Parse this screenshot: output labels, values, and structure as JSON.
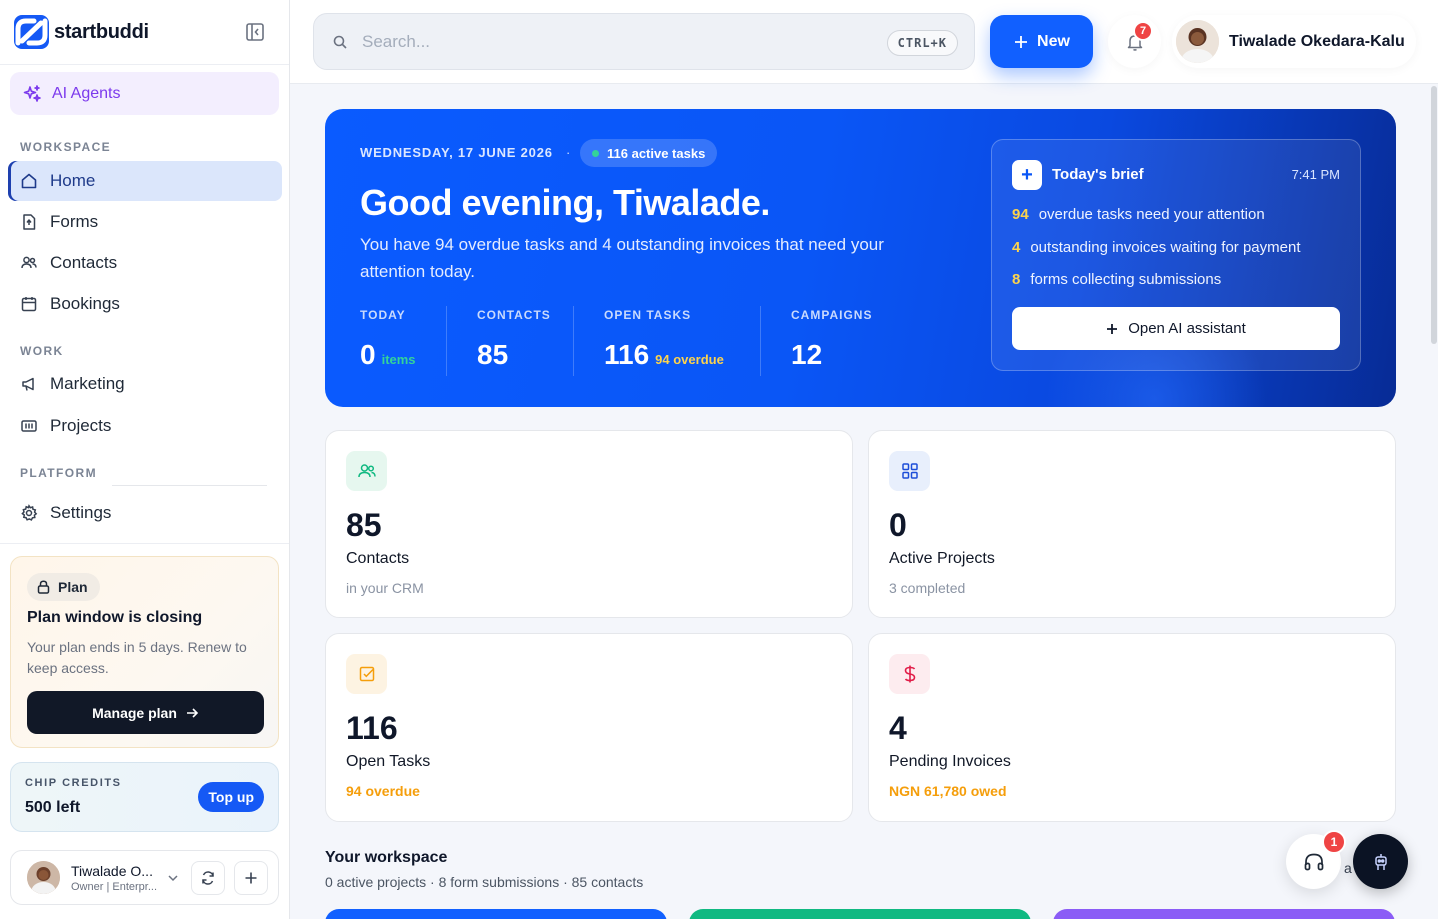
{
  "brand": {
    "name": "startbuddi"
  },
  "sidebar": {
    "ai_agents": "AI Agents",
    "sections": {
      "workspace": "WORKSPACE",
      "work": "WORK",
      "platform": "PLATFORM"
    },
    "items": {
      "home": "Home",
      "forms": "Forms",
      "contacts": "Contacts",
      "bookings": "Bookings",
      "marketing": "Marketing",
      "projects": "Projects",
      "settings": "Settings"
    },
    "active_item": "Home"
  },
  "plan": {
    "badge": "Plan",
    "title": "Plan window is closing",
    "description": "Your plan ends in 5 days. Renew to keep access.",
    "button": "Manage plan"
  },
  "credits": {
    "label": "CHIP CREDITS",
    "value": "500 left",
    "button": "Top up"
  },
  "user": {
    "name": "Tiwalade O...",
    "role": "Owner | Enterpr..."
  },
  "topbar": {
    "search_placeholder": "Search...",
    "shortcut": "CTRL+K",
    "new_button": "New",
    "notifications_count": "7",
    "profile_name": "Tiwalade Okedara-Kalu"
  },
  "hero": {
    "date": "WEDNESDAY, 17 JUNE 2026",
    "separator": "·",
    "active_tasks": "116 active tasks",
    "greeting": "Good evening, Tiwalade.",
    "subtitle": "You have 94 overdue tasks and 4 outstanding invoices that need your attention today.",
    "stats": [
      {
        "label": "TODAY",
        "value": "0",
        "note": "items"
      },
      {
        "label": "CONTACTS",
        "value": "85",
        "note": ""
      },
      {
        "label": "OPEN TASKS",
        "value": "116",
        "note": "94 overdue"
      },
      {
        "label": "CAMPAIGNS",
        "value": "12",
        "note": ""
      }
    ],
    "brief": {
      "title": "Today's brief",
      "time": "7:41 PM",
      "rows": [
        {
          "num": "94",
          "text": "overdue tasks need your attention"
        },
        {
          "num": "4",
          "text": "outstanding invoices waiting for payment"
        },
        {
          "num": "8",
          "text": "forms collecting submissions"
        }
      ],
      "button": "Open AI assistant"
    }
  },
  "cards": [
    {
      "value": "85",
      "label": "Contacts",
      "sub": "in your CRM",
      "icon": "users-icon",
      "accent": "#10b981"
    },
    {
      "value": "0",
      "label": "Active Projects",
      "sub": "3 completed",
      "icon": "grid-icon",
      "accent": "#1d4ed8"
    },
    {
      "value": "116",
      "label": "Open Tasks",
      "sub": "94 overdue",
      "icon": "check-square-icon",
      "accent": "#f59e0b"
    },
    {
      "value": "4",
      "label": "Pending Invoices",
      "sub": "NGN 61,780 owed",
      "icon": "dollar-icon",
      "accent": "#e11d48"
    }
  ],
  "workspace": {
    "title": "Your workspace",
    "subtitle": "0 active projects · 8 form submissions · 85 contacts"
  },
  "floating": {
    "help_badge": "1",
    "help_peek": "a"
  },
  "colors": {
    "brand_blue": "#1160ff",
    "hero_blue": "#0a56f6",
    "active_nav_bg": "#dbe6fb",
    "ai_purple": "#7c3aed",
    "warning": "#f59e0b",
    "danger": "#ef4444"
  }
}
